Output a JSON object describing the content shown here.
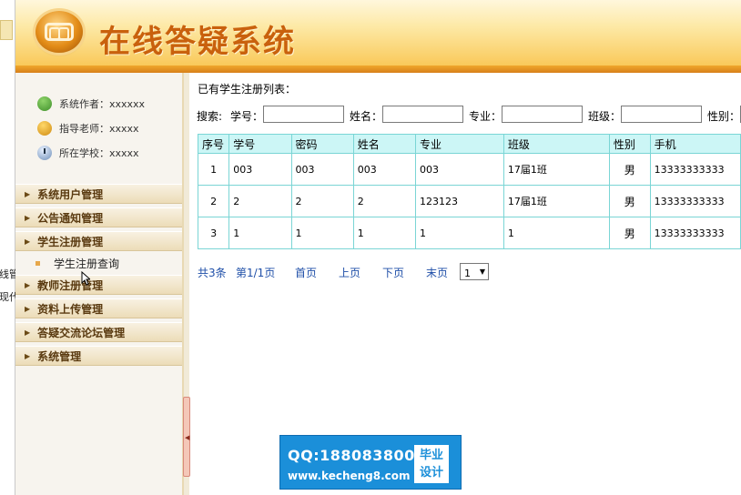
{
  "left_strip": {
    "fragments": [
      "线管",
      "现代"
    ]
  },
  "header": {
    "title": "在线答疑系统"
  },
  "sidebar": {
    "info": [
      {
        "label": "系统作者：xxxxxx",
        "icon": "user-group-icon"
      },
      {
        "label": "指导老师：xxxxx",
        "icon": "teacher-icon"
      },
      {
        "label": "所在学校：xxxxx",
        "icon": "clock-icon"
      }
    ],
    "menu": [
      {
        "label": "系统用户管理"
      },
      {
        "label": "公告通知管理"
      },
      {
        "label": "学生注册管理"
      },
      {
        "label": "教师注册管理"
      },
      {
        "label": "资料上传管理"
      },
      {
        "label": "答疑交流论坛管理"
      },
      {
        "label": "系统管理"
      }
    ],
    "sub_item": {
      "label": "学生注册查询"
    }
  },
  "main": {
    "list_title": "已有学生注册列表：",
    "search": {
      "prefix": "搜索:",
      "fields": [
        "学号：",
        "姓名：",
        "专业：",
        "班级：",
        "性别："
      ]
    },
    "table": {
      "headers": [
        "序号",
        "学号",
        "密码",
        "姓名",
        "专业",
        "班级",
        "性别",
        "手机"
      ],
      "rows": [
        [
          "1",
          "003",
          "003",
          "003",
          "003",
          "17届1班",
          "男",
          "13333333333"
        ],
        [
          "2",
          "2",
          "2",
          "2",
          "123123",
          "17届1班",
          "男",
          "13333333333"
        ],
        [
          "3",
          "1",
          "1",
          "1",
          "1",
          "1",
          "男",
          "13333333333"
        ]
      ]
    },
    "pager": {
      "total": "共3条",
      "page": "第1/1页",
      "first": "首页",
      "prev": "上页",
      "next": "下页",
      "last": "末页",
      "select_value": "1"
    }
  },
  "watermark": {
    "line1": "QQ:188083800",
    "line2": "www.kecheng8.com",
    "badge_line1": "毕业",
    "badge_line2": "设计"
  }
}
